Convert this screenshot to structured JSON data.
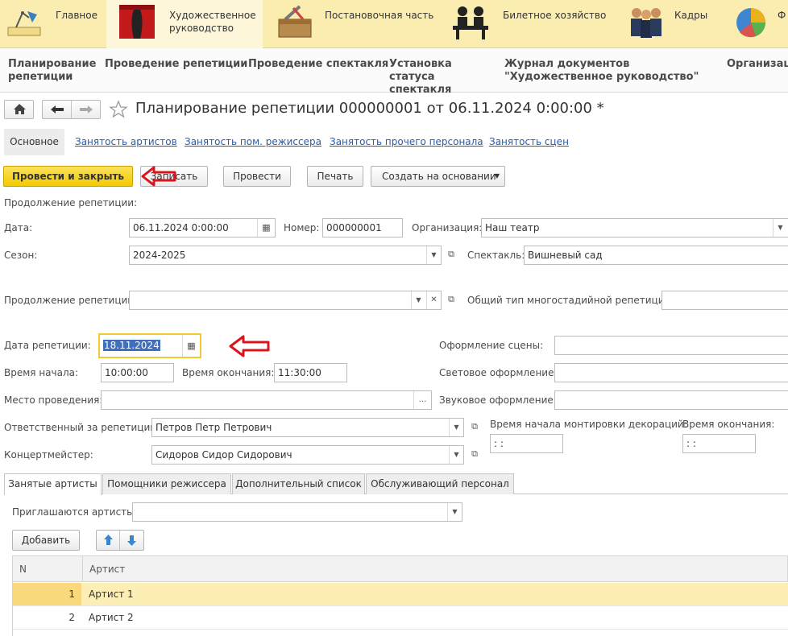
{
  "sections": [
    {
      "label": "Главное",
      "icon": "desk-lamp-icon"
    },
    {
      "label": "Художественное руководство",
      "icon": "theater-curtain-icon"
    },
    {
      "label": "Постановочная часть",
      "icon": "toolbox-icon"
    },
    {
      "label": "Билетное хозяйство",
      "icon": "ticket-desk-icon"
    },
    {
      "label": "Кадры",
      "icon": "people-icon"
    },
    {
      "label": "Ф",
      "icon": "pie-chart-icon"
    }
  ],
  "subnav": [
    "Планирование репетиции",
    "Проведение репетиции",
    "Проведение спектакля",
    "Установка статуса спектакля",
    "Журнал документов \"Художественное руководство\"",
    "Организации"
  ],
  "title": "Планирование репетиции 000000001 от 06.11.2024 0:00:00 *",
  "form_tabs": [
    "Основное",
    "Занятость артистов",
    "Занятость пом. режиссера",
    "Занятость прочего персонала",
    "Занятость сцен"
  ],
  "buttons": {
    "post_close": "Провести и закрыть",
    "write": "Записать",
    "post": "Провести",
    "print": "Печать",
    "create_based": "Создать на основании"
  },
  "labels": {
    "continuation_header": "Продолжение репетиции:",
    "date": "Дата:",
    "number": "Номер:",
    "organization": "Организация:",
    "season": "Сезон:",
    "performance": "Спектакль:",
    "continuation": "Продолжение репетиции:",
    "common_type": "Общий тип многостадийной репетиции:",
    "rehearsal_date": "Дата репетиции:",
    "stage_design": "Оформление сцены:",
    "start_time": "Время начала:",
    "end_time": "Время окончания:",
    "lighting": "Световое оформление:",
    "venue": "Место проведения:",
    "sound": "Звуковое оформление:",
    "responsible": "Ответственный за репетицию:",
    "decor_start": "Время начала монтировки декораций:",
    "decor_end": "Время окончания:",
    "accompanist": "Концертмейстер:",
    "invited": "Приглашаются артисты:"
  },
  "values": {
    "date": "06.11.2024  0:00:00",
    "number": "000000001",
    "organization": "Наш театр",
    "season": "2024-2025",
    "performance": "Вишневый сад",
    "continuation": "",
    "common_type": "",
    "rehearsal_date": "18.11.2024",
    "start_time": "10:00:00",
    "end_time": "11:30:00",
    "venue": "",
    "stage_design": "",
    "lighting": "",
    "sound": "",
    "responsible": "Петров Петр Петрович",
    "accompanist": "Сидоров Сидор Сидорович",
    "decor_start": " :  : ",
    "decor_end": " :  : ",
    "invited": ""
  },
  "bottom_tabs": [
    "Занятые артисты",
    "Помощники режиссера",
    "Дополнительный список",
    "Обслуживающий персонал"
  ],
  "add_button": "Добавить",
  "table": {
    "columns": [
      "N",
      "Артист"
    ],
    "rows": [
      {
        "n": "1",
        "artist": "Артист 1"
      },
      {
        "n": "2",
        "artist": "Артист 2"
      }
    ]
  },
  "colors": {
    "accent": "#f2c900",
    "topbar": "#fbedb0",
    "link": "#2a5ba8",
    "selection_row": "#fdeeb5",
    "annotation_arrow": "#d9141b"
  }
}
